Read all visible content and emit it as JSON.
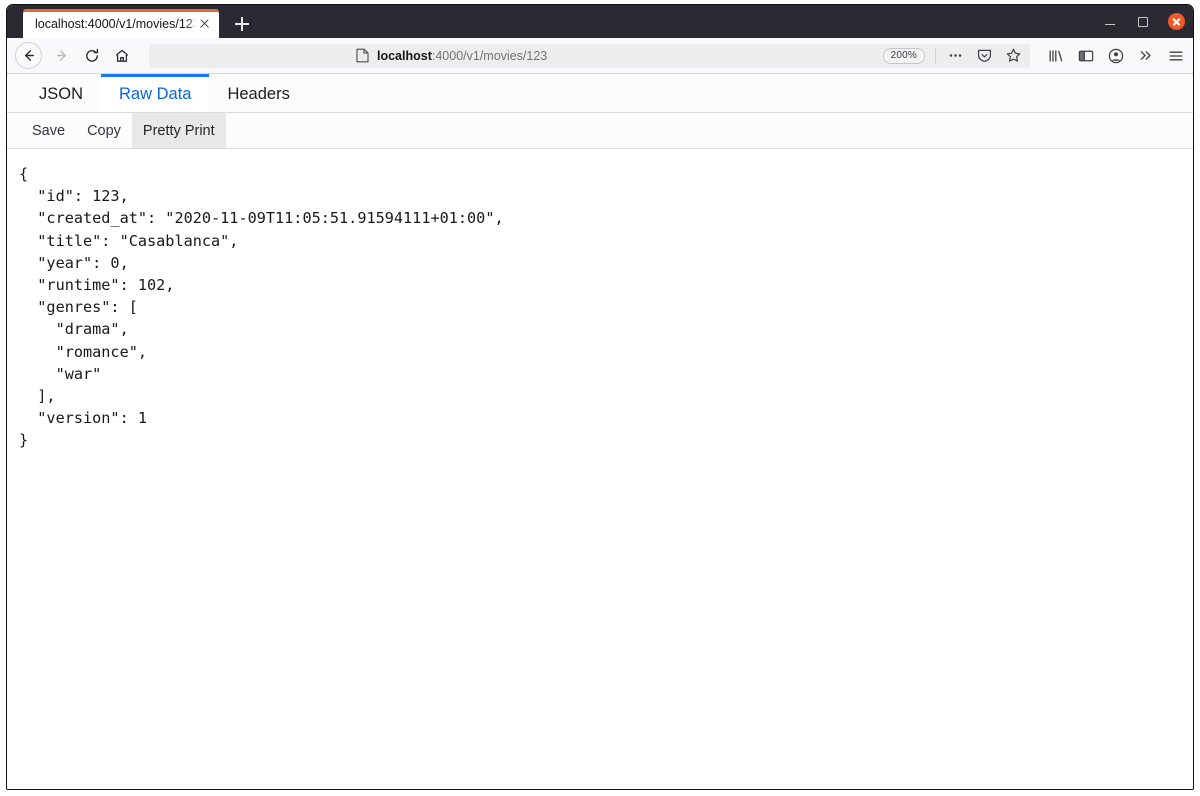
{
  "window": {
    "controls": {
      "minimize_label": "Minimize",
      "maximize_label": "Maximize",
      "close_label": "Close"
    }
  },
  "tabstrip": {
    "tabs": [
      {
        "title": "localhost:4000/v1/movies/123",
        "close_label": "Close tab",
        "active": true
      }
    ],
    "new_tab_label": "New tab"
  },
  "navbar": {
    "back_label": "Back",
    "forward_label": "Forward",
    "reload_label": "Reload",
    "home_label": "Home",
    "url": {
      "host": "localhost",
      "rest": ":4000/v1/movies/123",
      "full": "localhost:4000/v1/movies/123",
      "page_icon": "page-icon"
    },
    "zoom_level": "200%",
    "icons": [
      "ellipsis-icon",
      "reader-shield-icon",
      "bookmark-star-icon",
      "library-icon",
      "sidebar-icon",
      "account-icon",
      "overflow-chevrons-icon",
      "hamburger-menu-icon"
    ]
  },
  "viewer": {
    "tabs": [
      {
        "label": "JSON",
        "active": false
      },
      {
        "label": "Raw Data",
        "active": true
      },
      {
        "label": "Headers",
        "active": false
      }
    ],
    "toolbar": [
      {
        "label": "Save",
        "pressed": false
      },
      {
        "label": "Copy",
        "pressed": false
      },
      {
        "label": "Pretty Print",
        "pressed": true
      }
    ],
    "accent_color": "#1677f0",
    "active_tab_text_color": "#0a67d8"
  },
  "content": {
    "raw_json": "{\n  \"id\": 123,\n  \"created_at\": \"2020-11-09T11:05:51.91594111+01:00\",\n  \"title\": \"Casablanca\",\n  \"year\": 0,\n  \"runtime\": 102,\n  \"genres\": [\n    \"drama\",\n    \"romance\",\n    \"war\"\n  ],\n  \"version\": 1\n}",
    "fields": {
      "id": 123,
      "created_at": "2020-11-09T11:05:51.91594111+01:00",
      "title": "Casablanca",
      "year": 0,
      "runtime": 102,
      "genres": [
        "drama",
        "romance",
        "war"
      ],
      "version": 1
    }
  },
  "colors": {
    "tab_accent": "#e86a33",
    "tabstrip_bg": "#2b2a33",
    "close_button": "#ec5b2a",
    "link_blue": "#0a67d8"
  }
}
